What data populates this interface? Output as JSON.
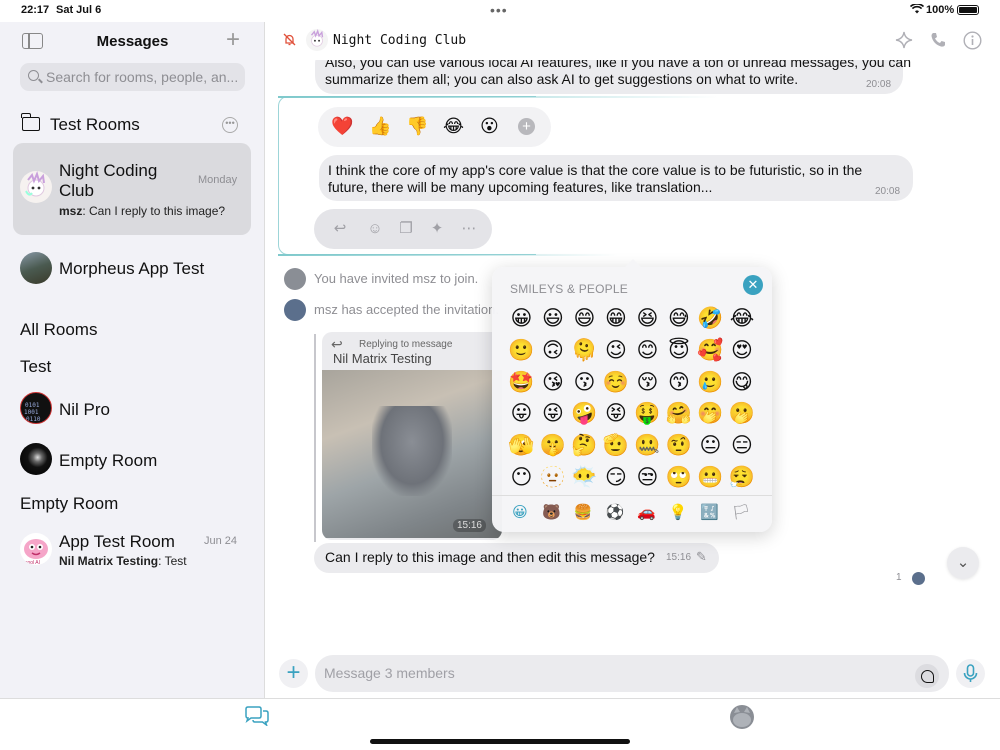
{
  "status": {
    "time": "22:17",
    "date": "Sat Jul 6",
    "battery": "100%"
  },
  "sidebar": {
    "title": "Messages",
    "search_placeholder": "Search for rooms, people, an...",
    "folder": "Test Rooms",
    "rooms": [
      {
        "name": "Night Coding Club",
        "date": "Monday",
        "sender": "msz",
        "preview": ": Can I reply to this image?"
      },
      {
        "name": "Morpheus App Test"
      }
    ],
    "section_all": "All Rooms",
    "section_test": "Test",
    "test_rooms": [
      {
        "name": "Nil Pro"
      },
      {
        "name": "Empty Room"
      }
    ],
    "section_empty": "Empty Room",
    "empty_rooms": [
      {
        "name": "App Test Room",
        "date": "Jun 24",
        "sender": "Nil Matrix Testing",
        "preview": ": Test"
      }
    ]
  },
  "chat": {
    "title": "Night Coding Club",
    "messages": {
      "m1_line1": "Also, you can use various local AI features, like if you have a ton of unread messages, you can",
      "m1_line2": "summarize them all; you can also ask AI to get suggestions on what to write.",
      "m1_time": "20:08",
      "m2_line1": "I think the core of my app's core value is that the core value is to be futuristic, so in the",
      "m2_line2": "future, there will be many upcoming features, like translation...",
      "m2_time": "20:08",
      "sys1": "You have invited msz to join.",
      "sys2": "msz has accepted the invitation.",
      "reply_tag": "Replying to message",
      "reply_name": "Nil Matrix Testing",
      "reply_img_time": "15:16",
      "last_text": "Can I reply to this image and then edit this message?",
      "last_time": "15:16",
      "read_count": "1"
    },
    "reactions": [
      "❤️",
      "👍",
      "👎",
      "😂",
      "😮"
    ],
    "emoji_panel": {
      "title": "SMILEYS & PEOPLE",
      "emojis": [
        "😀",
        "😃",
        "😄",
        "😁",
        "😆",
        "😅",
        "🤣",
        "😂",
        "🙂",
        "🙃",
        "🫠",
        "😉",
        "😊",
        "😇",
        "🥰",
        "😍",
        "🤩",
        "😘",
        "😗",
        "☺️",
        "😚",
        "😙",
        "🥲",
        "😋",
        "😛",
        "😜",
        "🤪",
        "😝",
        "🤑",
        "🤗",
        "🤭",
        "🫢",
        "🫣",
        "🤫",
        "🤔",
        "🫡",
        "🤐",
        "🤨",
        "😐",
        "😑",
        "😶",
        "🫥",
        "😶‍🌫️",
        "😏",
        "😒",
        "🙄",
        "😬",
        "😮‍💨"
      ],
      "categories": [
        "😀",
        "🐻",
        "🍔",
        "⚽",
        "🚗",
        "💡",
        "🔣",
        "🏳"
      ]
    },
    "composer_placeholder": "Message 3 members"
  },
  "colors": {
    "accent": "#3aa2c0",
    "sidebar_bg": "#f2f2f7",
    "bubble_bg": "#ebebee"
  }
}
